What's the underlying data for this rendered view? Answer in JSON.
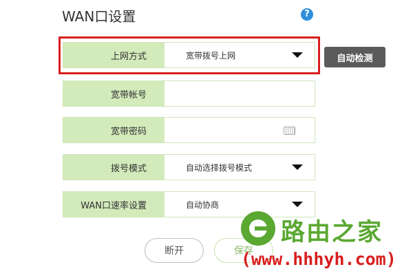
{
  "header": {
    "title": "WAN口设置",
    "help_glyph": "?"
  },
  "form": {
    "connection_type": {
      "label": "上网方式",
      "value": "宽带拨号上网"
    },
    "account": {
      "label": "宽带帐号",
      "value": ""
    },
    "password": {
      "label": "宽带密码",
      "value": ""
    },
    "dial_mode": {
      "label": "拨号模式",
      "value": "自动选择拨号模式"
    },
    "wan_speed": {
      "label": "WAN口速率设置",
      "value": "自动协商"
    }
  },
  "buttons": {
    "auto_detect": "自动检测",
    "disconnect": "断开",
    "save": "保存"
  },
  "watermark": {
    "brand": "路由之家",
    "url": "(www.hhhyh.com)"
  },
  "colors": {
    "label_bg": "#d3eabb",
    "highlight": "#d81e1e",
    "help": "#2f8fdc",
    "watermark_green": "#5aa832"
  }
}
